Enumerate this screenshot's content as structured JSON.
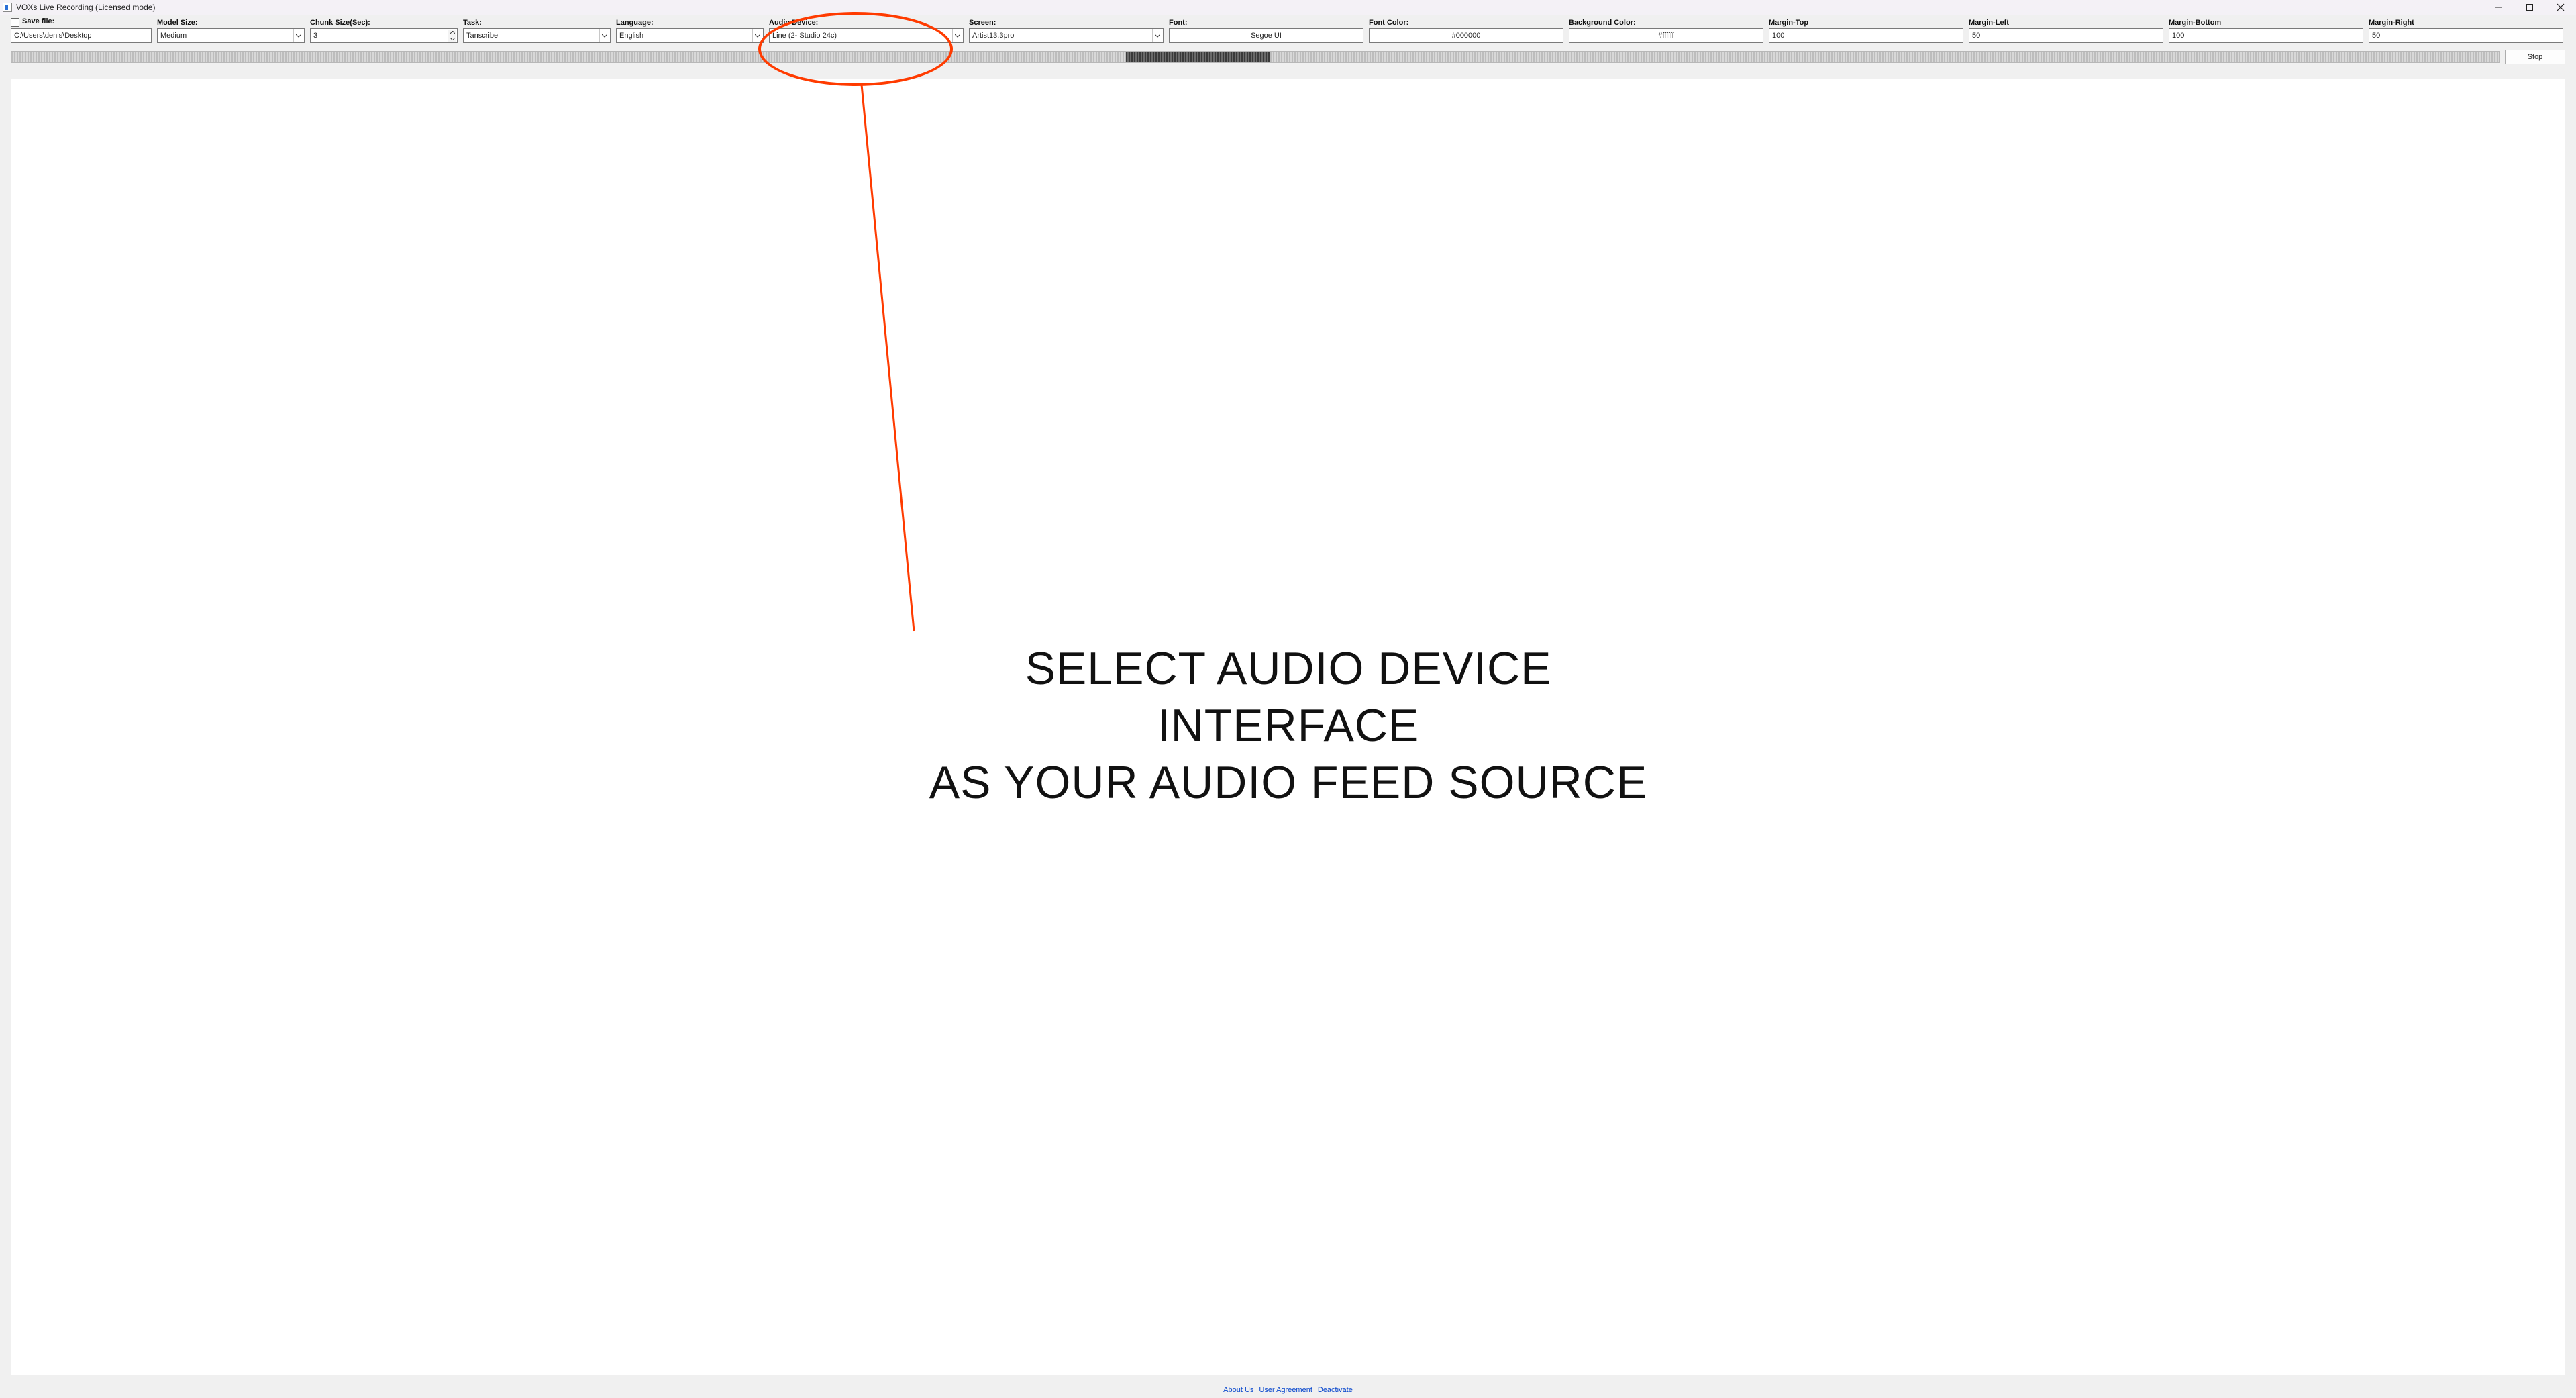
{
  "window": {
    "title": "VOXs Live Recording (Licensed mode)"
  },
  "toolbar": {
    "save_file": {
      "label": "Save file:",
      "value": "C:\\Users\\denis\\Desktop"
    },
    "model_size": {
      "label": "Model Size:",
      "value": "Medium"
    },
    "chunk_size": {
      "label": "Chunk Size(Sec):",
      "value": "3"
    },
    "task": {
      "label": "Task:",
      "value": "Tanscribe"
    },
    "language": {
      "label": "Language:",
      "value": "English"
    },
    "audio_device": {
      "label": "Audio Device:",
      "value": "Line (2- Studio 24c)"
    },
    "screen": {
      "label": "Screen:",
      "value": "Artist13.3pro"
    },
    "font": {
      "label": "Font:",
      "value": "Segoe UI"
    },
    "font_color": {
      "label": "Font Color:",
      "value": "#000000"
    },
    "bg_color": {
      "label": "Background Color:",
      "value": "#ffffff"
    },
    "margin_top": {
      "label": "Margin-Top",
      "value": "100"
    },
    "margin_left": {
      "label": "Margin-Left",
      "value": "50"
    },
    "margin_bottom": {
      "label": "Margin-Bottom",
      "value": "100"
    },
    "margin_right": {
      "label": "Margin-Right",
      "value": "50"
    }
  },
  "stop_label": "Stop",
  "annotation": {
    "line1": "SELECT AUDIO DEVICE INTERFACE",
    "line2": "AS YOUR AUDIO FEED SOURCE"
  },
  "footer": {
    "about": "About Us",
    "agreement": "User Agreement",
    "deactivate": "Deactivate"
  }
}
